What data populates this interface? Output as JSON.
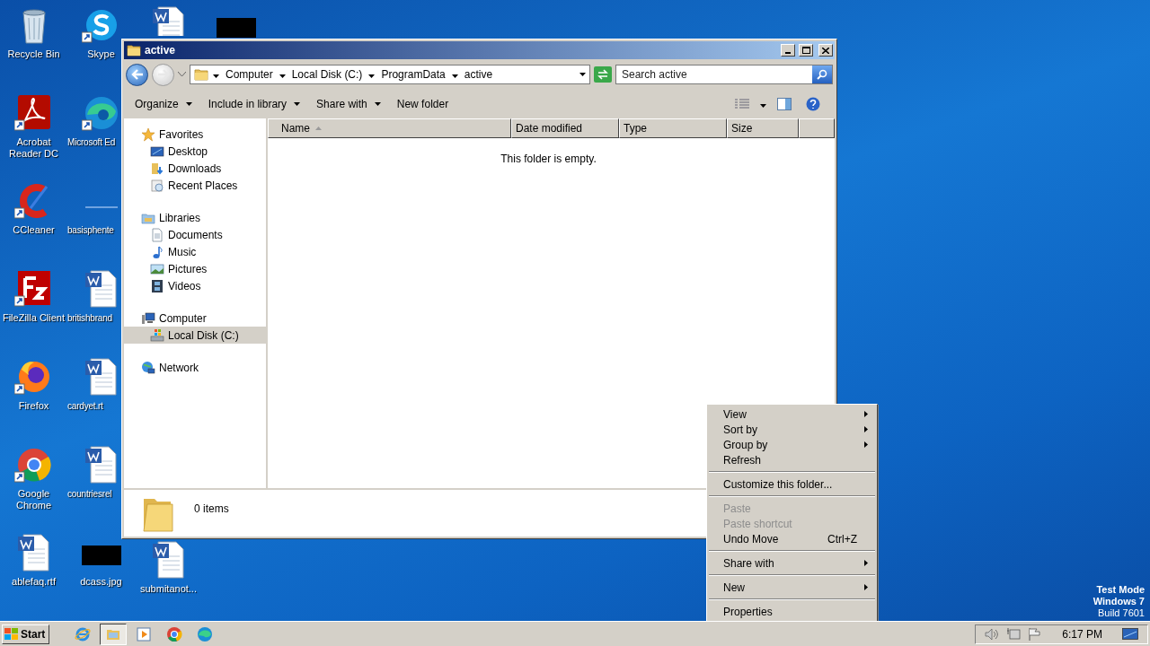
{
  "desktop": {
    "icon_columns": [
      [
        {
          "label": "Recycle Bin",
          "kind": "trash"
        },
        {
          "label": "Acrobat Reader DC",
          "kind": "pdf",
          "shortcut": true
        },
        {
          "label": "CCleaner",
          "kind": "cleaner",
          "shortcut": true
        },
        {
          "label": "FileZilla Client",
          "kind": "ftp",
          "shortcut": true
        },
        {
          "label": "Firefox",
          "kind": "firefox",
          "shortcut": true
        },
        {
          "label": "Google Chrome",
          "kind": "chrome",
          "shortcut": true
        },
        {
          "label": "ablefaq.rtf",
          "kind": "word"
        }
      ],
      [
        {
          "label": "Skype",
          "kind": "chat",
          "shortcut": true
        },
        {
          "label": "Microsoft Ed",
          "kind": "edge",
          "shortcut": true
        },
        {
          "label": "basisphente",
          "kind": "blank"
        },
        {
          "label": "britishbrand",
          "kind": "word"
        },
        {
          "label": "cardyet.rt",
          "kind": "word"
        },
        {
          "label": "countriesrel",
          "kind": "word"
        },
        {
          "label": "dcass.jpg",
          "kind": "image"
        }
      ],
      [
        {
          "kind": "word"
        },
        {
          "label": "submitanot...",
          "kind": "word"
        }
      ],
      [
        {
          "kind": "image"
        }
      ]
    ],
    "os_notice": [
      "Test Mode",
      "Windows 7",
      "Build 7601"
    ]
  },
  "window": {
    "title": "active",
    "address": [
      "Computer",
      "Local Disk (C:)",
      "ProgramData",
      "active"
    ],
    "search": {
      "placeholder": "Search active"
    },
    "toolbar": [
      {
        "label": "Organize",
        "dropdown": true
      },
      {
        "label": "Include in library",
        "dropdown": true
      },
      {
        "label": "Share with",
        "dropdown": true
      },
      {
        "label": "New folder",
        "dropdown": false
      }
    ],
    "nav": [
      {
        "label": "Favorites",
        "kind": "star",
        "selected": false,
        "children": [
          {
            "label": "Desktop",
            "kind": "desktop",
            "selected": false
          },
          {
            "label": "Downloads",
            "kind": "downloads",
            "selected": false
          },
          {
            "label": "Recent Places",
            "kind": "recent",
            "selected": false
          }
        ]
      },
      {
        "label": "Libraries",
        "kind": "library",
        "selected": false,
        "children": [
          {
            "label": "Documents",
            "kind": "document",
            "selected": false
          },
          {
            "label": "Music",
            "kind": "music",
            "selected": false
          },
          {
            "label": "Pictures",
            "kind": "pictures",
            "selected": false
          },
          {
            "label": "Videos",
            "kind": "video",
            "selected": false
          }
        ]
      },
      {
        "label": "Computer",
        "kind": "computer",
        "selected": false,
        "children": [
          {
            "label": "Local Disk (C:)",
            "kind": "disk",
            "selected": true
          }
        ]
      },
      {
        "label": "Network",
        "kind": "network",
        "selected": false
      }
    ],
    "columns": [
      {
        "label": "Name",
        "sorted": true
      },
      {
        "label": "Date modified",
        "sorted": false
      },
      {
        "label": "Type",
        "sorted": false
      },
      {
        "label": "Size",
        "sorted": false
      }
    ],
    "empty_message": "This folder is empty.",
    "status": "0 items"
  },
  "context_menu": [
    {
      "kind": "item",
      "label": "View",
      "submenu": true,
      "disabled": false
    },
    {
      "kind": "item",
      "label": "Sort by",
      "submenu": true,
      "disabled": false
    },
    {
      "kind": "item",
      "label": "Group by",
      "submenu": true,
      "disabled": false
    },
    {
      "kind": "item",
      "label": "Refresh",
      "submenu": false,
      "disabled": false
    },
    {
      "kind": "separator"
    },
    {
      "kind": "item",
      "label": "Customize this folder...",
      "submenu": false,
      "disabled": false
    },
    {
      "kind": "separator"
    },
    {
      "kind": "item",
      "label": "Paste",
      "submenu": false,
      "disabled": true
    },
    {
      "kind": "item",
      "label": "Paste shortcut",
      "submenu": false,
      "disabled": true
    },
    {
      "kind": "item",
      "label": "Undo Move",
      "shortcut": "Ctrl+Z",
      "submenu": false,
      "disabled": false
    },
    {
      "kind": "separator"
    },
    {
      "kind": "item",
      "label": "Share with",
      "submenu": true,
      "disabled": false
    },
    {
      "kind": "separator"
    },
    {
      "kind": "item",
      "label": "New",
      "submenu": true,
      "disabled": false
    },
    {
      "kind": "separator"
    },
    {
      "kind": "item",
      "label": "Properties",
      "submenu": false,
      "disabled": false
    }
  ],
  "taskbar": {
    "start": "Start",
    "apps": [
      {
        "kind": "ie",
        "selected": false
      },
      {
        "kind": "explorer",
        "selected": true
      },
      {
        "kind": "media",
        "selected": false
      },
      {
        "kind": "chrome",
        "selected": false
      },
      {
        "kind": "edge",
        "selected": false
      }
    ],
    "clock": "6:17 PM"
  }
}
